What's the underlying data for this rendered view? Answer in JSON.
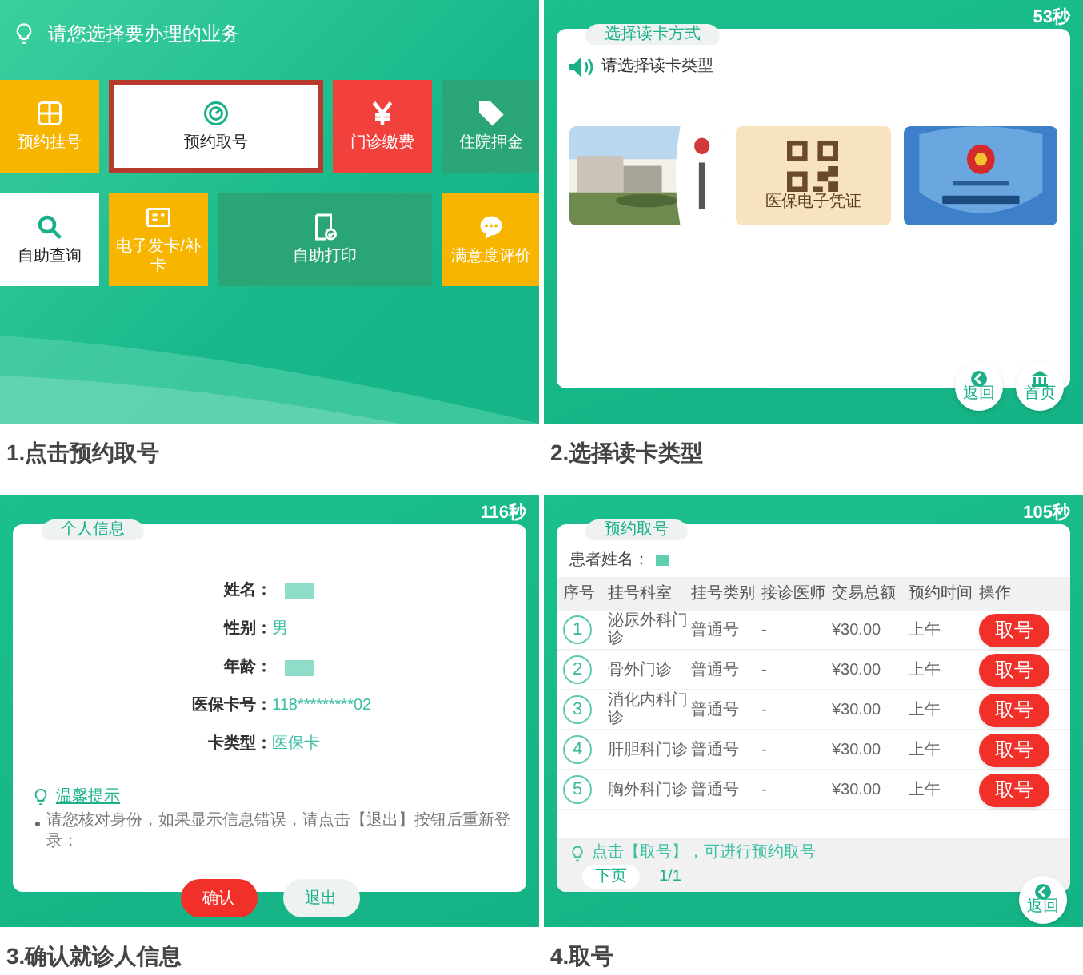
{
  "menu_screen": {
    "prompt": "请您选择要办理的业务",
    "tiles": [
      {
        "label": "预约挂号",
        "color": "#f7b500",
        "selected": false,
        "wide": false
      },
      {
        "label": "预约取号",
        "color": "#ffffff",
        "selected": true,
        "wide": true
      },
      {
        "label": "门诊缴费",
        "color": "#f2403c",
        "selected": false,
        "wide": false
      },
      {
        "label": "住院押金",
        "color": "#2aa676",
        "selected": false,
        "wide": false
      },
      {
        "label": "自助查询",
        "color": "#ffffff",
        "selected": false,
        "wide": false
      },
      {
        "label": "电子发卡/补卡",
        "color": "#f7b500",
        "selected": false,
        "wide": false
      },
      {
        "label": "自助打印",
        "color": "#2aa676",
        "selected": false,
        "wide": true
      },
      {
        "label": "满意度评价",
        "color": "#f7b500",
        "selected": false,
        "wide": false
      }
    ],
    "caption": "1.点击预约取号"
  },
  "card_screen": {
    "timer": "53秒",
    "tab": "选择读卡方式",
    "prompt": "请选择读卡类型",
    "cards": [
      {
        "kind": "picture"
      },
      {
        "kind": "qr",
        "label": "医保电子凭证"
      },
      {
        "kind": "picture"
      }
    ],
    "buttons": [
      "返回",
      "首页"
    ],
    "caption": "2.选择读卡类型"
  },
  "info_screen": {
    "timer": "116秒",
    "tab": "个人信息",
    "fields": [
      {
        "label": "姓名：",
        "kind": "masked"
      },
      {
        "label": "性别：",
        "kind": "text",
        "value": "男"
      },
      {
        "label": "年龄：",
        "kind": "masked"
      },
      {
        "label": "医保卡号：",
        "kind": "text",
        "value": "118*********02"
      },
      {
        "label": "卡类型：",
        "kind": "text",
        "value": "医保卡"
      }
    ],
    "tip_title": "温馨提示",
    "tip": "请您核对身份，如果显示信息错误，请点击【退出】按钮后重新登录；",
    "buttons": [
      "确认",
      "退出"
    ],
    "caption": "3.确认就诊人信息"
  },
  "ticket_screen": {
    "timer": "105秒",
    "tab": "预约取号",
    "patient_label": "患者姓名：",
    "columns": [
      "序号",
      "挂号科室",
      "挂号类别",
      "接诊医师",
      "交易总额",
      "预约时间",
      "操作"
    ],
    "rows": [
      {
        "no": "1",
        "dept": "泌尿外科门诊",
        "type": "普通号",
        "doctor": "-",
        "amount": "¥30.00",
        "time": "上午",
        "action": "取号"
      },
      {
        "no": "2",
        "dept": "骨外门诊",
        "type": "普通号",
        "doctor": "-",
        "amount": "¥30.00",
        "time": "上午",
        "action": "取号"
      },
      {
        "no": "3",
        "dept": "消化内科门诊",
        "type": "普通号",
        "doctor": "-",
        "amount": "¥30.00",
        "time": "上午",
        "action": "取号"
      },
      {
        "no": "4",
        "dept": "肝胆科门诊",
        "type": "普通号",
        "doctor": "-",
        "amount": "¥30.00",
        "time": "上午",
        "action": "取号"
      },
      {
        "no": "5",
        "dept": "胸外科门诊",
        "type": "普通号",
        "doctor": "-",
        "amount": "¥30.00",
        "time": "上午",
        "action": "取号"
      }
    ],
    "hint": "点击【取号】，可进行预约取号",
    "next": "下页",
    "page": "1/1",
    "back": "返回",
    "caption": "4.取号"
  }
}
